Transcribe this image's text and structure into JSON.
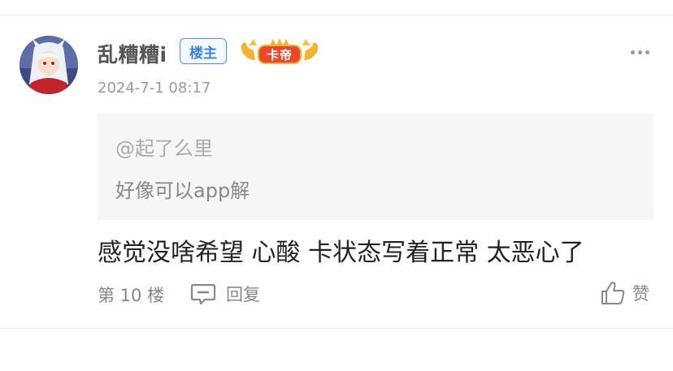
{
  "post": {
    "username": "乱糟糟i",
    "owner_badge": "楼主",
    "rank_badge": "卡帝",
    "timestamp": "2024-7-1 08:17",
    "quote": {
      "user": "@起了么里",
      "text": "好像可以app解"
    },
    "content": "感觉没啥希望 心酸 卡状态写着正常 太恶心了",
    "floor": "第 10 楼",
    "reply_label": "回复",
    "like_label": "赞"
  },
  "icons": {
    "more": "more-dots-icon",
    "reply": "comment-bubble-icon",
    "like": "thumbs-up-icon",
    "rank": "crown-badge-icon"
  },
  "colors": {
    "owner_badge": "#4a90e2",
    "rank_badge": "#e8482c",
    "rank_wings": "#f2b233"
  }
}
